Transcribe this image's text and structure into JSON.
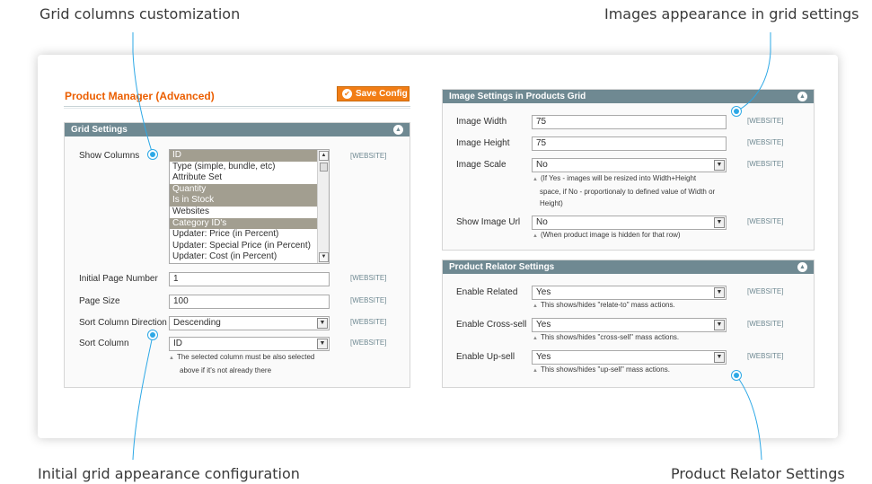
{
  "callouts": {
    "grid_columns": "Grid columns customization",
    "images_appearance": "Images appearance in grid settings",
    "initial_grid": "Initial grid appearance configuration",
    "relator": "Product Relator Settings"
  },
  "page": {
    "title": "Product Manager (Advanced)",
    "save_label": "Save Config"
  },
  "colors": {
    "accent": "#eb5e00",
    "button": "#f27d15",
    "panel_header": "#6f8992",
    "callout_line": "#2da8e6",
    "selected_option": "#a29e90"
  },
  "grid_settings": {
    "title": "Grid Settings",
    "show_columns": {
      "label": "Show Columns",
      "scope": "[WEBSITE]",
      "options": [
        {
          "text": "ID",
          "selected": true
        },
        {
          "text": "Type (simple, bundle, etc)",
          "selected": false
        },
        {
          "text": "Attribute Set",
          "selected": false
        },
        {
          "text": "Quantity",
          "selected": true
        },
        {
          "text": "Is in Stock",
          "selected": true
        },
        {
          "text": "Websites",
          "selected": false
        },
        {
          "text": "Category ID's",
          "selected": true
        },
        {
          "text": "Updater: Price (in Percent)",
          "selected": false
        },
        {
          "text": "Updater: Special Price (in Percent)",
          "selected": false
        },
        {
          "text": "Updater: Cost (in Percent)",
          "selected": false
        }
      ]
    },
    "initial_page": {
      "label": "Initial Page Number",
      "value": "1",
      "scope": "[WEBSITE]"
    },
    "page_size": {
      "label": "Page Size",
      "value": "100",
      "scope": "[WEBSITE]"
    },
    "sort_direction": {
      "label": "Sort Column Direction",
      "value": "Descending",
      "scope": "[WEBSITE]"
    },
    "sort_column": {
      "label": "Sort Column",
      "value": "ID",
      "scope": "[WEBSITE]",
      "note_line1": "The selected column must be also selected",
      "note_line2": "above if it's not already there"
    }
  },
  "image_settings": {
    "title": "Image Settings in Products Grid",
    "width": {
      "label": "Image Width",
      "value": "75",
      "scope": "[WEBSITE]"
    },
    "height": {
      "label": "Image Height",
      "value": "75",
      "scope": "[WEBSITE]"
    },
    "scale": {
      "label": "Image Scale",
      "value": "No",
      "scope": "[WEBSITE]",
      "note_line1": "(If Yes - images will be resized into Width+Height",
      "note_line2": "space, if No - proportionaly to defined value of Width or",
      "note_line3": "Height)"
    },
    "show_url": {
      "label": "Show Image Url",
      "value": "No",
      "scope": "[WEBSITE]",
      "note": "(When product image is hidden for that row)"
    }
  },
  "relator_settings": {
    "title": "Product Relator Settings",
    "related": {
      "label": "Enable Related",
      "value": "Yes",
      "scope": "[WEBSITE]",
      "note": "This shows/hides \"relate-to\" mass actions."
    },
    "cross_sell": {
      "label": "Enable Cross-sell",
      "value": "Yes",
      "scope": "[WEBSITE]",
      "note": "This shows/hides \"cross-sell\" mass actions."
    },
    "up_sell": {
      "label": "Enable Up-sell",
      "value": "Yes",
      "scope": "[WEBSITE]",
      "note": "This shows/hides \"up-sell\" mass actions."
    }
  }
}
